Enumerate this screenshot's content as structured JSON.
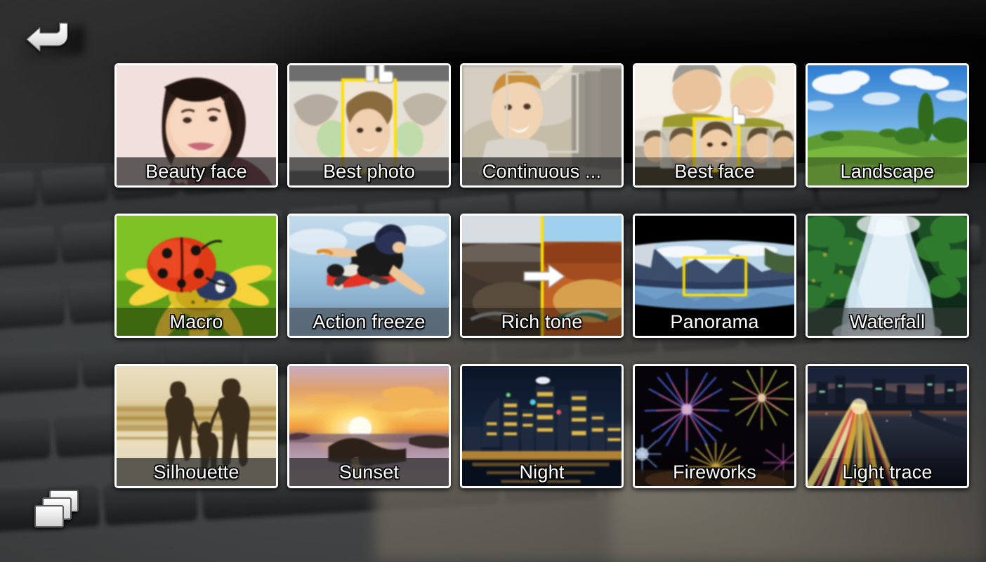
{
  "app": {
    "title": "Camera Shooting Mode",
    "back_icon": "back-arrow-icon",
    "stack_icon": "mode-stack-icon"
  },
  "grid": {
    "columns": 5,
    "rows": 3,
    "tiles": [
      {
        "label": "Beauty face",
        "art": "beauty",
        "label_style": "lb-dim"
      },
      {
        "label": "Best photo",
        "art": "bestphoto",
        "label_style": "lb-dim"
      },
      {
        "label": "Continuous ...",
        "art": "continuous",
        "label_style": "lb-dim"
      },
      {
        "label": "Best face",
        "art": "bestface",
        "label_style": "lb-clear"
      },
      {
        "label": "Landscape",
        "art": "landscape",
        "label_style": "lb-clear"
      },
      {
        "label": "Macro",
        "art": "macro",
        "label_style": "lb-clear"
      },
      {
        "label": "Action freeze",
        "art": "action",
        "label_style": "lb-light"
      },
      {
        "label": "Rich tone",
        "art": "richtone",
        "label_style": "lb-clear"
      },
      {
        "label": "Panorama",
        "art": "panorama",
        "label_style": "lb-none"
      },
      {
        "label": "Waterfall",
        "art": "waterfall",
        "label_style": "lb-light"
      },
      {
        "label": "Silhouette",
        "art": "silhouette",
        "label_style": "lb-dim"
      },
      {
        "label": "Sunset",
        "art": "sunset",
        "label_style": "lb-dim"
      },
      {
        "label": "Night",
        "art": "night",
        "label_style": "lb-none"
      },
      {
        "label": "Fireworks",
        "art": "fireworks",
        "label_style": "lb-none"
      },
      {
        "label": "Light trace",
        "art": "lighttrace",
        "label_style": "lb-none"
      }
    ]
  },
  "colors": {
    "tile_border": "#ffffff",
    "label_text": "#ffffff",
    "selection_frame": "#ffe000",
    "background_dark": "#0a0a0a",
    "keyboard_grey": "#55585a"
  }
}
